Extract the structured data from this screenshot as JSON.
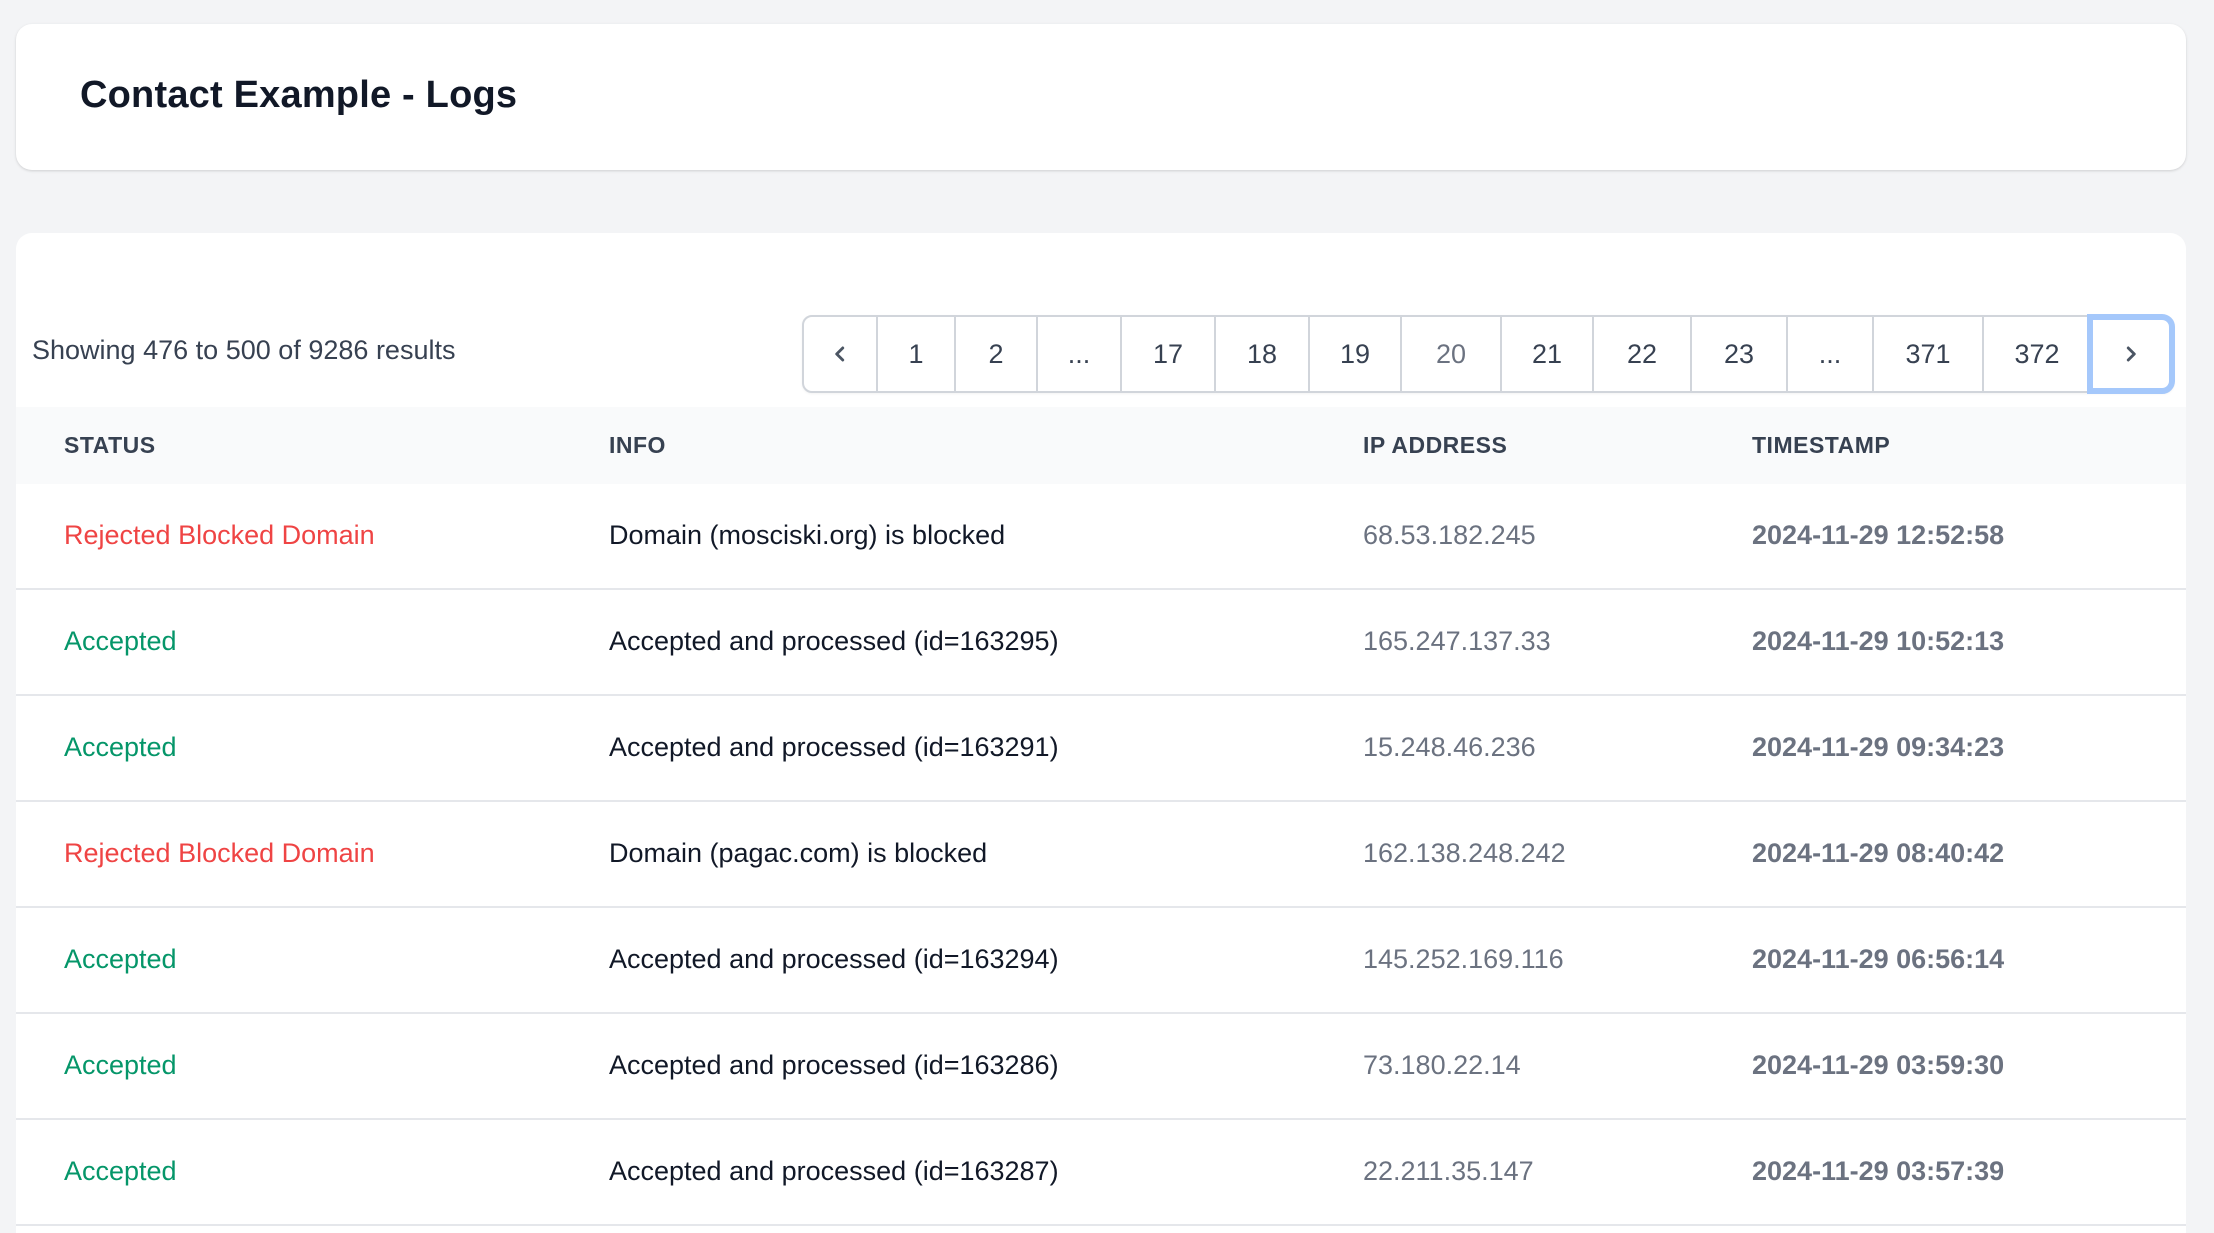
{
  "header": {
    "title": "Contact Example - Logs"
  },
  "summary": {
    "prefix": "Showing",
    "from": "476",
    "to_word": "to",
    "to": "500",
    "of_word": "of",
    "total": "9286",
    "suffix": "results"
  },
  "pagination": {
    "prev_icon": "chevron-left-icon",
    "next_icon": "chevron-right-icon",
    "current_page": "20",
    "pages": [
      {
        "label": "1",
        "type": "page"
      },
      {
        "label": "2",
        "type": "page"
      },
      {
        "label": "...",
        "type": "ellipsis"
      },
      {
        "label": "17",
        "type": "page"
      },
      {
        "label": "18",
        "type": "page"
      },
      {
        "label": "19",
        "type": "page"
      },
      {
        "label": "20",
        "type": "current"
      },
      {
        "label": "21",
        "type": "page"
      },
      {
        "label": "22",
        "type": "page"
      },
      {
        "label": "23",
        "type": "page"
      },
      {
        "label": "...",
        "type": "ellipsis"
      },
      {
        "label": "371",
        "type": "page"
      },
      {
        "label": "372",
        "type": "page"
      }
    ]
  },
  "table": {
    "columns": [
      "STATUS",
      "INFO",
      "IP ADDRESS",
      "TIMESTAMP"
    ],
    "status_colors": {
      "accepted": "#059669",
      "rejected": "#ef4444"
    },
    "rows": [
      {
        "status": "Rejected Blocked Domain",
        "status_type": "rejected",
        "info": "Domain (mosciski.org) is blocked",
        "ip": "68.53.182.245",
        "timestamp": "2024-11-29 12:52:58"
      },
      {
        "status": "Accepted",
        "status_type": "accepted",
        "info": "Accepted and processed (id=163295)",
        "ip": "165.247.137.33",
        "timestamp": "2024-11-29 10:52:13"
      },
      {
        "status": "Accepted",
        "status_type": "accepted",
        "info": "Accepted and processed (id=163291)",
        "ip": "15.248.46.236",
        "timestamp": "2024-11-29 09:34:23"
      },
      {
        "status": "Rejected Blocked Domain",
        "status_type": "rejected",
        "info": "Domain (pagac.com) is blocked",
        "ip": "162.138.248.242",
        "timestamp": "2024-11-29 08:40:42"
      },
      {
        "status": "Accepted",
        "status_type": "accepted",
        "info": "Accepted and processed (id=163294)",
        "ip": "145.252.169.116",
        "timestamp": "2024-11-29 06:56:14"
      },
      {
        "status": "Accepted",
        "status_type": "accepted",
        "info": "Accepted and processed (id=163286)",
        "ip": "73.180.22.14",
        "timestamp": "2024-11-29 03:59:30"
      },
      {
        "status": "Accepted",
        "status_type": "accepted",
        "info": "Accepted and processed (id=163287)",
        "ip": "22.211.35.147",
        "timestamp": "2024-11-29 03:57:39"
      }
    ]
  }
}
